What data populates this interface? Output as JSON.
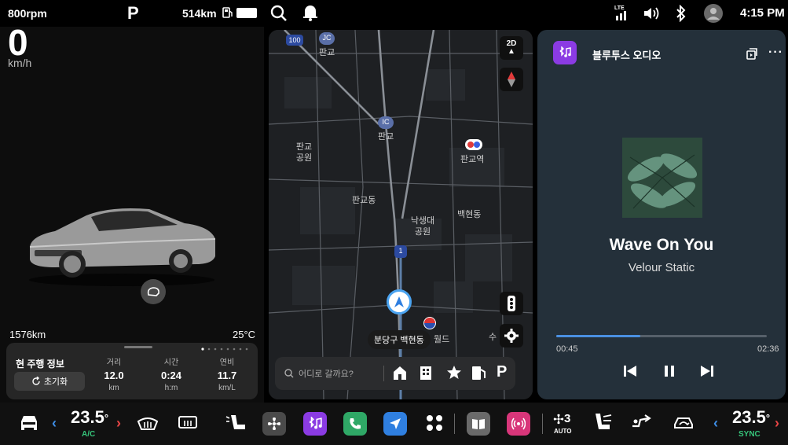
{
  "status_bar": {
    "rpm": "800rpm",
    "gear": "P",
    "range": "514km",
    "time": "4:15 PM",
    "icons": [
      "fuel-icon",
      "battery-icon",
      "search-icon",
      "bell-icon",
      "lte-signal-icon",
      "volume-icon",
      "bluetooth-icon",
      "user-icon"
    ]
  },
  "vehicle": {
    "speed": "0",
    "speed_unit": "km/h",
    "odometer": "1576km",
    "outside_temp": "25°C",
    "trip": {
      "title": "현 주행 정보",
      "reset_label": "초기화",
      "columns": [
        {
          "label": "거리",
          "value": "12.0",
          "unit": "km"
        },
        {
          "label": "시간",
          "value": "0:24",
          "unit": "h:m"
        },
        {
          "label": "연비",
          "value": "11.7",
          "unit": "km/L"
        }
      ]
    }
  },
  "map": {
    "view_mode": "2D",
    "labels": [
      "판교",
      "판교",
      "판교 공원",
      "판교역",
      "판교동",
      "낙생대 공원",
      "백현동",
      "월드",
      "수"
    ],
    "shields": [
      "100",
      "JC",
      "IC",
      "1"
    ],
    "current_location": "분당구 백현동",
    "search_placeholder": "어디로 갈까요?",
    "quick_icons": [
      "home-icon",
      "office-icon",
      "star-icon",
      "fuel-station-icon",
      "parking-icon"
    ],
    "parking_letter": "P"
  },
  "media": {
    "source": "블루투스 오디오",
    "title": "Wave On You",
    "artist": "Velour Static",
    "elapsed": "00:45",
    "total": "02:36",
    "progress": 0.4,
    "accent": "#4a90e2"
  },
  "climate": {
    "driver_temp": "23.5",
    "driver_sub": "A/C",
    "passenger_temp": "23.5",
    "passenger_sub": "SYNC",
    "fan_level": "3",
    "fan_mode": "AUTO",
    "degree": "°"
  }
}
